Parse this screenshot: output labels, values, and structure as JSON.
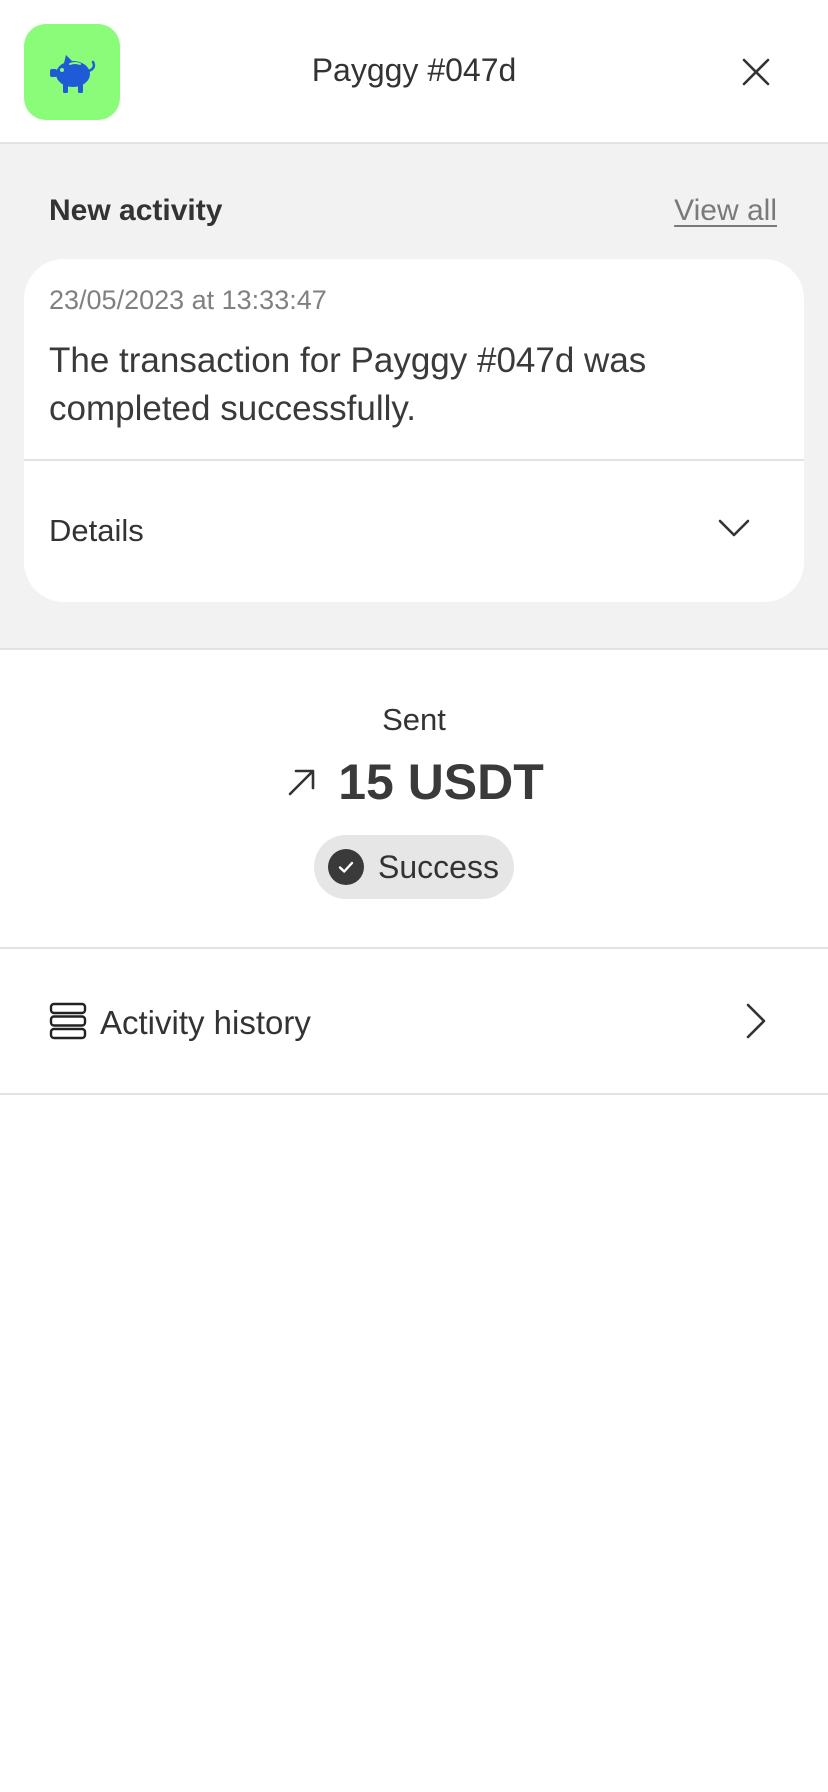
{
  "header": {
    "title": "Payggy #047d",
    "app_icon": "piggy-bank-icon",
    "close_icon": "close-icon",
    "brand_color": "#8afc7a",
    "icon_color": "#1f5bd6"
  },
  "activity": {
    "section_title": "New activity",
    "view_all_label": "View all",
    "card": {
      "timestamp": "23/05/2023 at 13:33:47",
      "message": "The transaction for Payggy #047d was completed successfully.",
      "details_label": "Details",
      "details_icon": "chevron-down-icon"
    }
  },
  "transaction": {
    "direction_label": "Sent",
    "direction_icon": "arrow-up-right-icon",
    "amount": "15 USDT",
    "status_label": "Success",
    "status_icon": "check-circle-icon"
  },
  "history": {
    "label": "Activity history",
    "icon": "list-icon",
    "chevron_icon": "chevron-right-icon"
  }
}
